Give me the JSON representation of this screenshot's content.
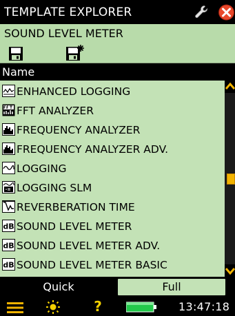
{
  "window": {
    "title": "TEMPLATE EXPLORER",
    "subtitle": "SOUND LEVEL METER"
  },
  "titlebar": {
    "icons": [
      "wrench-icon",
      "close-icon"
    ]
  },
  "toolbar": {
    "icons": [
      "save-icon",
      "save-new-icon"
    ]
  },
  "list": {
    "header": "Name",
    "items": [
      {
        "label": "ENHANCED LOGGING",
        "icon": "enhanced-logging-icon"
      },
      {
        "label": "FFT ANALYZER",
        "icon": "fft-icon"
      },
      {
        "label": "FREQUENCY ANALYZER",
        "icon": "frequency-bars-icon"
      },
      {
        "label": "FREQUENCY ANALYZER ADV.",
        "icon": "frequency-bars-icon"
      },
      {
        "label": "LOGGING",
        "icon": "logging-icon"
      },
      {
        "label": "LOGGING SLM",
        "icon": "logging-slm-icon"
      },
      {
        "label": "REVERBERATION TIME",
        "icon": "reverberation-icon"
      },
      {
        "label": "SOUND LEVEL METER",
        "icon": "db-icon"
      },
      {
        "label": "SOUND LEVEL METER ADV.",
        "icon": "db-icon"
      },
      {
        "label": "SOUND LEVEL METER BASIC",
        "icon": "db-icon"
      }
    ],
    "scroll_position": 0.5
  },
  "tabs": [
    {
      "label": "Quick",
      "selected": false
    },
    {
      "label": "Full",
      "selected": true
    }
  ],
  "status": {
    "time": "13:47:18",
    "icons": [
      "menu-icon",
      "backlight-icon",
      "help-icon",
      "battery-icon"
    ],
    "help_glyph": "?"
  },
  "colors": {
    "accent_green": "#c3e2b6",
    "header_green": "#b8dbaa",
    "scroll_thumb": "#f2b300",
    "close_red": "#e8482a"
  }
}
